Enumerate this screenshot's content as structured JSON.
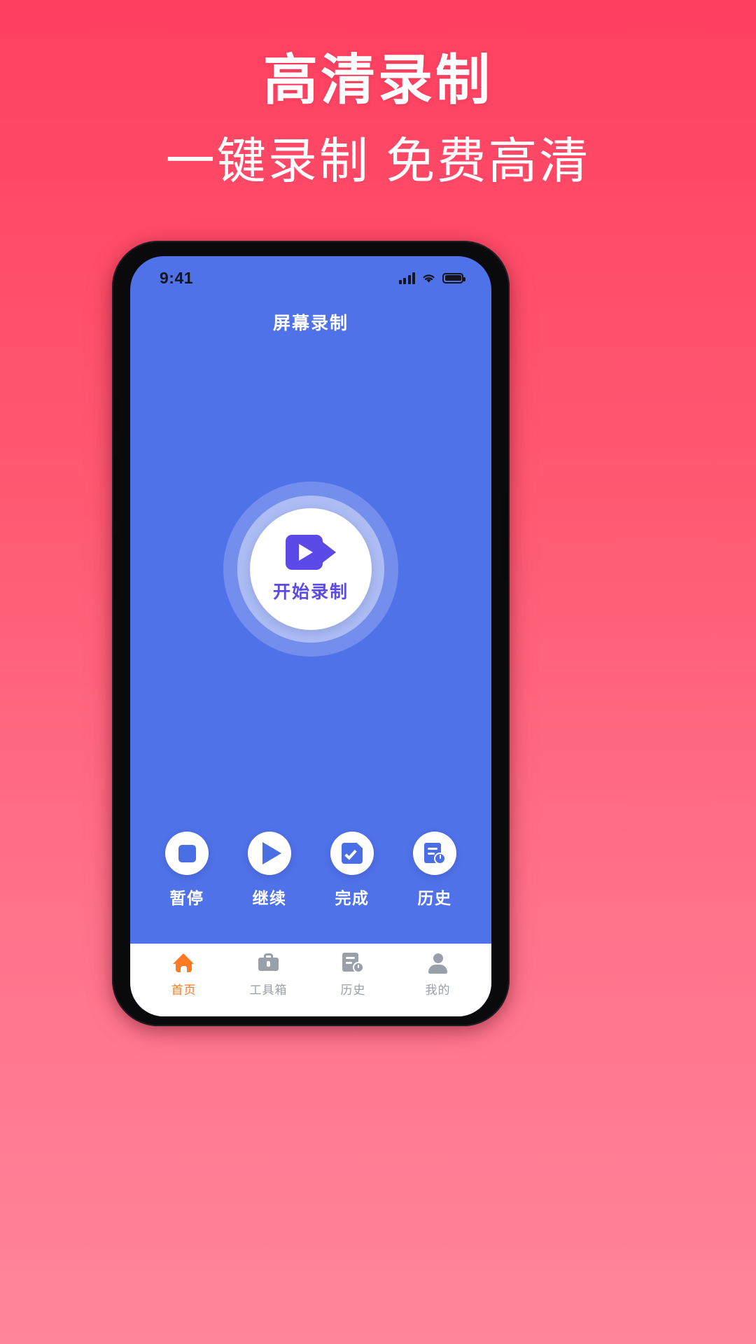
{
  "promo": {
    "title": "高清录制",
    "subtitle": "一键录制 免费高清"
  },
  "colors": {
    "bg_top": "#ff3f60",
    "bg_bottom": "#ff859a",
    "app_bg": "#5072e8",
    "accent_purple": "#5b4ae8",
    "accent_blue": "#4a6fe5",
    "tab_active": "#ff7a22",
    "tab_inactive": "#9aa0aa"
  },
  "phone": {
    "status_bar": {
      "time": "9:41",
      "signal_icon": "signal-bars-icon",
      "wifi_icon": "wifi-icon",
      "battery_icon": "battery-icon"
    },
    "app_bar": {
      "title": "屏幕录制"
    },
    "record_button": {
      "label": "开始录制",
      "icon": "video-camera-play-icon"
    },
    "actions": [
      {
        "label": "暂停",
        "icon": "stop-square-icon"
      },
      {
        "label": "继续",
        "icon": "play-triangle-icon"
      },
      {
        "label": "完成",
        "icon": "document-check-icon"
      },
      {
        "label": "历史",
        "icon": "document-clock-icon"
      }
    ],
    "tabs": [
      {
        "label": "首页",
        "icon": "home-icon",
        "active": true
      },
      {
        "label": "工具箱",
        "icon": "toolbox-icon",
        "active": false
      },
      {
        "label": "历史",
        "icon": "document-clock-icon",
        "active": false
      },
      {
        "label": "我的",
        "icon": "person-icon",
        "active": false
      }
    ]
  }
}
